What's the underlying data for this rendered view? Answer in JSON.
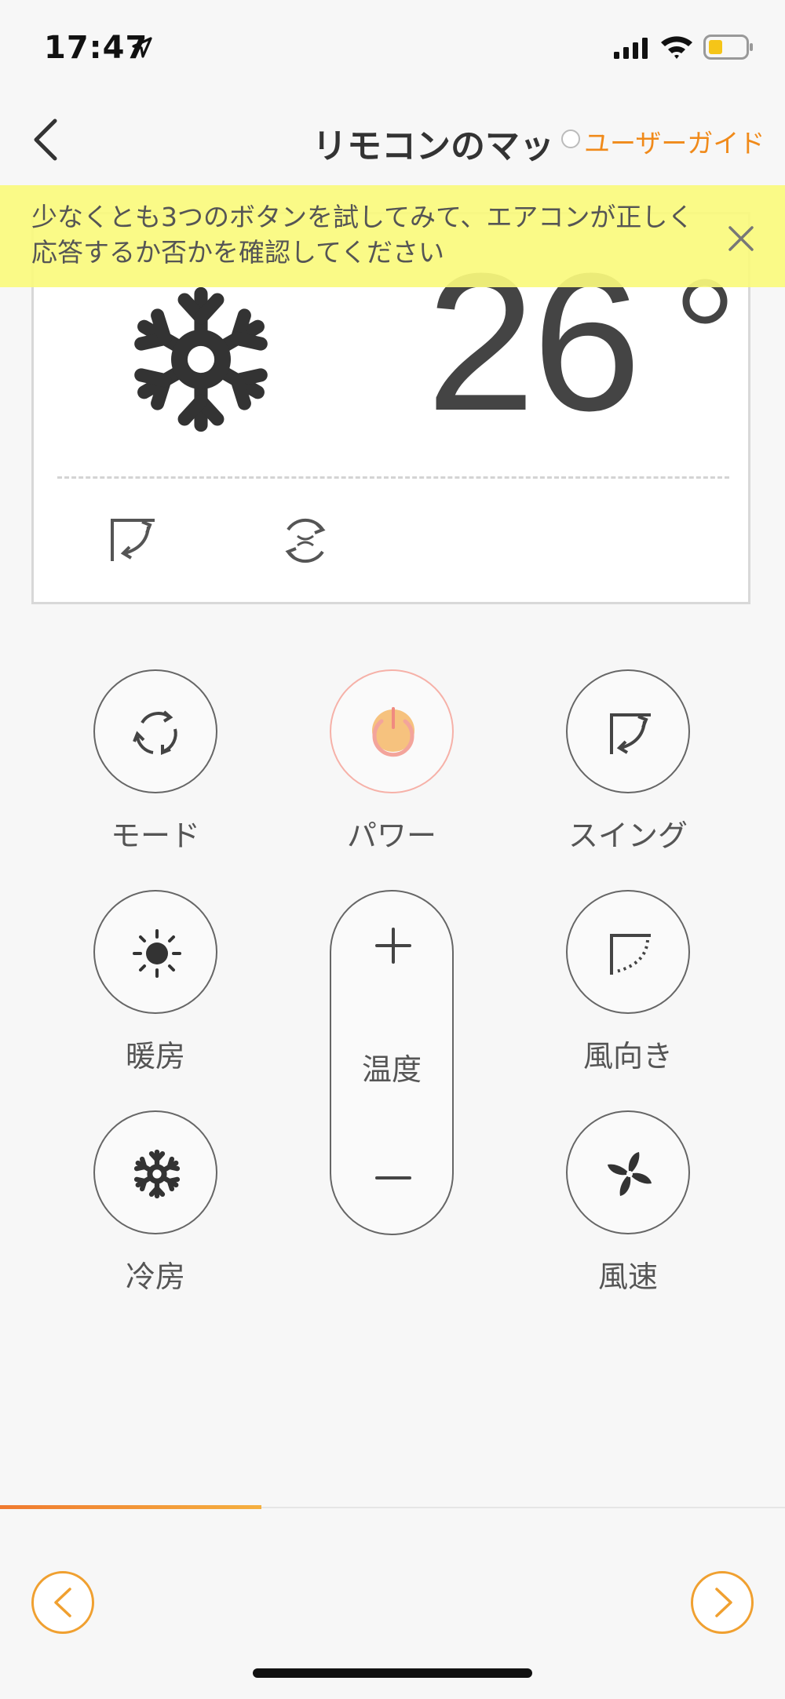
{
  "status_bar": {
    "time": "17:47"
  },
  "nav": {
    "title": "リモコンのマッ",
    "guide_label": "ユーザーガイド"
  },
  "hint": {
    "text": "少なくとも3つのボタンを試してみて、エアコンが正しく応答するか否かを確認してください"
  },
  "display": {
    "temperature": "26",
    "mode_icon": "snowflake-icon",
    "indicators": [
      "swing-icon",
      "fan-cycle-icon"
    ]
  },
  "buttons": {
    "mode": "モード",
    "power": "パワー",
    "swing": "スイング",
    "heat": "暖房",
    "temp": "温度",
    "wind_direction": "風向き",
    "cool": "冷房",
    "fan_speed": "風速"
  },
  "progress": {
    "fraction": 0.333
  },
  "colors": {
    "accent": "#f08a1a",
    "banner": "#fafa7d",
    "power": "#f6c27e"
  }
}
